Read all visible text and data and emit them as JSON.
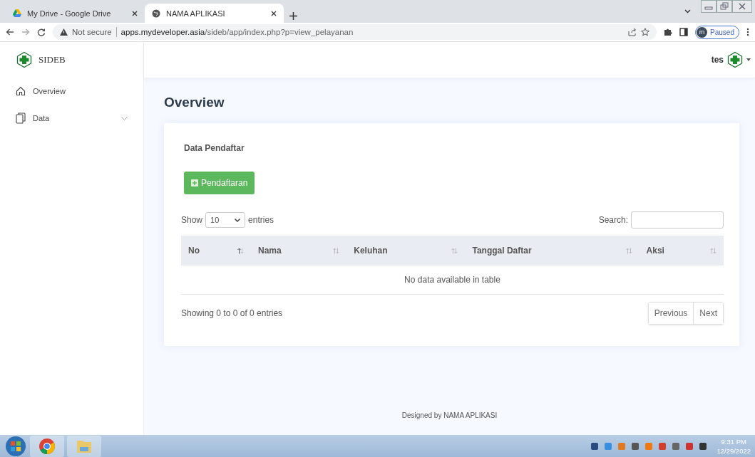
{
  "browser": {
    "tabs": [
      {
        "title": "My Drive - Google Drive",
        "selected": false
      },
      {
        "title": "NAMA APLIKASI",
        "selected": true
      }
    ],
    "address": {
      "warning": "Not secure",
      "host": "apps.mydeveloper.asia",
      "path": "/sideb/app/index.php?p=view_pelayanan"
    },
    "profile": {
      "initial": "m",
      "status": "Paused"
    }
  },
  "sidebar": {
    "brand": "SIDEB",
    "items": [
      {
        "label": "Overview",
        "kind": "home",
        "expandable": false
      },
      {
        "label": "Data",
        "kind": "pages",
        "expandable": true
      }
    ]
  },
  "header": {
    "user": "tes"
  },
  "page_title": "Overview",
  "card": {
    "title": "Data Pendaftar",
    "add_button": "Pendaftaran",
    "length": {
      "before": "Show",
      "value": "10",
      "after": "entries"
    },
    "search_label": "Search:",
    "table": {
      "columns": [
        {
          "label": "No",
          "sorted": true
        },
        {
          "label": "Nama",
          "sorted": false
        },
        {
          "label": "Keluhan",
          "sorted": false
        },
        {
          "label": "Tanggal Daftar",
          "sorted": false
        },
        {
          "label": "Aksi",
          "sorted": false
        }
      ],
      "empty": "No data available in table"
    },
    "info": "Showing 0 to 0 of 0 entries",
    "pager": [
      "Previous",
      "Next"
    ]
  },
  "footer": "Designed by NAMA APLIKASI",
  "taskbar": {
    "time": "9:31 PM",
    "date": "12/29/2022"
  }
}
